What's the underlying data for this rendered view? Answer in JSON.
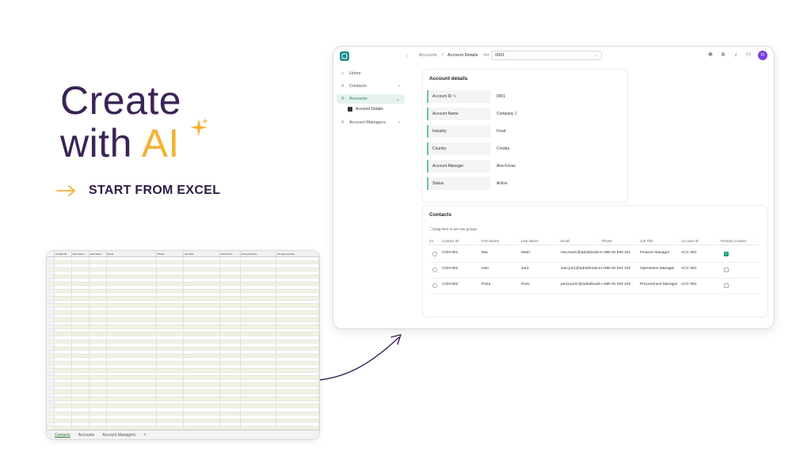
{
  "hero": {
    "line1": "Create",
    "line2_prefix": "with ",
    "line2_ai": "AI",
    "cta": "START FROM EXCEL"
  },
  "colors": {
    "purple": "#3a2456",
    "gold": "#f2b335",
    "teal": "#1a8a8a",
    "green_active": "#2b7d6b"
  },
  "excel": {
    "headers": [
      "",
      "Contact ID",
      "First Name",
      "Last Name",
      "Email",
      "Phone",
      "Job Title",
      "Account ID",
      "Account Name",
      "Primary Contact"
    ],
    "tabs": [
      "Contacts",
      "Accounts",
      "Account Managers",
      "+"
    ]
  },
  "app": {
    "breadcrumb": {
      "parent": "Accounts",
      "separator": "/",
      "current": "Account Details",
      "for_label": "for",
      "for_value": "0001"
    },
    "avatar_initials": "FI",
    "sidebar": {
      "home": "Home",
      "contacts": "Contacts",
      "accounts": "Accounts",
      "account_details": "Account Details",
      "account_managers": "Account Managers"
    },
    "details": {
      "title": "Account details",
      "fields": [
        {
          "label": "Account ID",
          "value": "0001"
        },
        {
          "label": "Account Name",
          "value": "Company 1"
        },
        {
          "label": "Industry",
          "value": "Food"
        },
        {
          "label": "Country",
          "value": "Croatia"
        },
        {
          "label": "Account Manager",
          "value": "Ana Kovac"
        },
        {
          "label": "Status",
          "value": "Active"
        }
      ]
    },
    "contacts": {
      "title": "Contacts",
      "group_hint": "Drag here to set row groups",
      "columns": [
        "Zo",
        "Contact ID",
        "First Name",
        "Last Name",
        "Email",
        "Phone",
        "Job Title",
        "Account ID",
        "Primary Contact"
      ],
      "rows": [
        {
          "id": "CON-001",
          "first": "Mia",
          "last": "Maric",
          "email": "mia.maric@adriafoods.example",
          "phone": "+385 91 500 101",
          "job": "Finance Manager",
          "account": "ACC-001",
          "primary": true
        },
        {
          "id": "CON-002",
          "first": "Ivan",
          "last": "Juric",
          "email": "ivan.juric@adriafoods.example",
          "phone": "+385 91 502 102",
          "job": "Operations Manager",
          "account": "ACC-001",
          "primary": false
        },
        {
          "id": "CON-003",
          "first": "Petra",
          "last": "Peric",
          "email": "petra.peric@adriafoods.example",
          "phone": "+385 91 503 103",
          "job": "Procurement Manager",
          "account": "ACC-001",
          "primary": false
        }
      ]
    }
  }
}
